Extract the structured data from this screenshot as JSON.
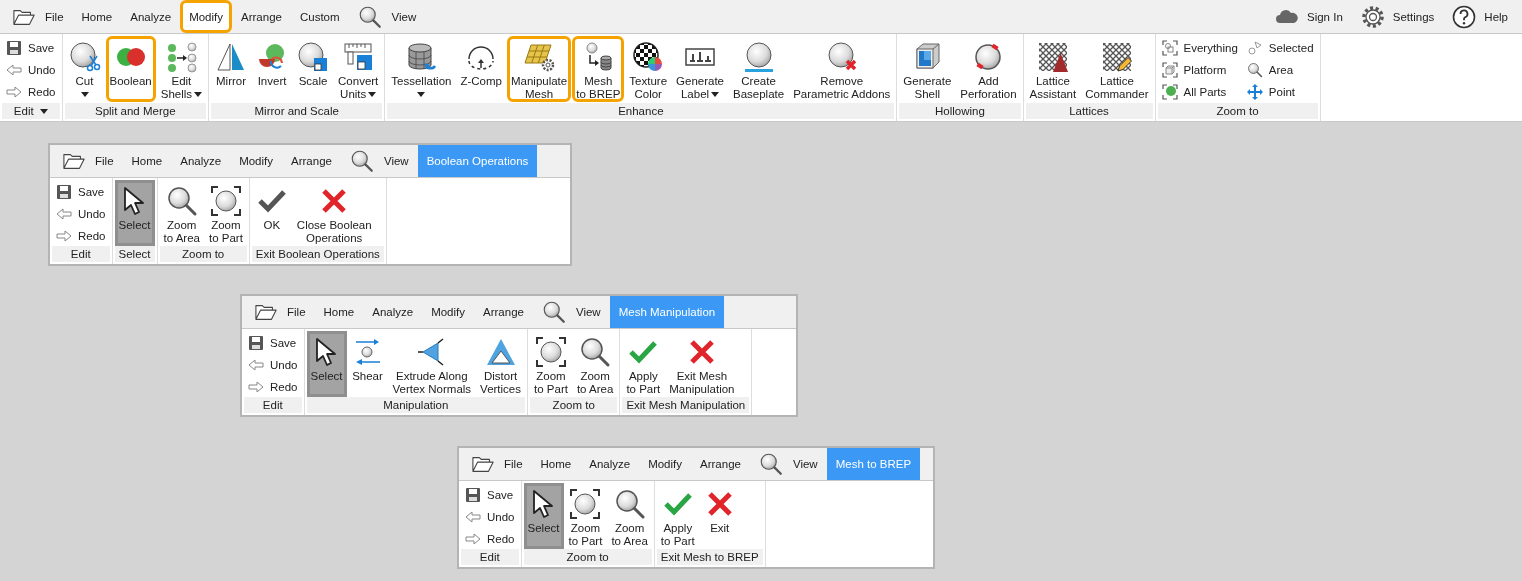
{
  "ribbons": [
    {
      "tabs": [
        {
          "label": "File",
          "kind": "file",
          "selected": false,
          "highlighted": false
        },
        {
          "label": "Home",
          "kind": "plain",
          "selected": false,
          "highlighted": false
        },
        {
          "label": "Analyze",
          "kind": "plain",
          "selected": false,
          "highlighted": false
        },
        {
          "label": "Modify",
          "kind": "plain",
          "selected": true,
          "highlighted": true
        },
        {
          "label": "Arrange",
          "kind": "plain",
          "selected": false,
          "highlighted": false
        },
        {
          "label": "Custom",
          "kind": "plain",
          "selected": false,
          "highlighted": false
        },
        {
          "label": "View",
          "kind": "view",
          "selected": false,
          "highlighted": false
        }
      ],
      "account": [
        {
          "label": "Sign In"
        },
        {
          "label": "Settings"
        },
        {
          "label": "Help"
        }
      ],
      "groups": [
        {
          "label": "Edit",
          "dropdown": true,
          "items": [
            {
              "kind": "stack",
              "items": [
                {
                  "label": "Save"
                },
                {
                  "label": "Undo"
                },
                {
                  "label": "Redo"
                }
              ]
            }
          ]
        },
        {
          "label": "Split and Merge",
          "items": [
            {
              "kind": "large",
              "label": "Cut",
              "dropdown": true,
              "selected": false,
              "highlighted": false
            },
            {
              "kind": "large",
              "label": "Boolean",
              "selected": false,
              "highlighted": true
            },
            {
              "kind": "large",
              "label": "Edit\nShells",
              "dropdown": true,
              "selected": false,
              "highlighted": false
            }
          ]
        },
        {
          "label": "Mirror and Scale",
          "items": [
            {
              "kind": "large",
              "label": "Mirror",
              "selected": false,
              "highlighted": false
            },
            {
              "kind": "large",
              "label": "Invert",
              "selected": false,
              "highlighted": false
            },
            {
              "kind": "large",
              "label": "Scale",
              "selected": false,
              "highlighted": false
            },
            {
              "kind": "large",
              "label": "Convert\nUnits",
              "dropdown": true,
              "selected": false,
              "highlighted": false
            }
          ]
        },
        {
          "label": "Enhance",
          "items": [
            {
              "kind": "large",
              "label": "Tessellation",
              "dropdown": true,
              "selected": false,
              "highlighted": false
            },
            {
              "kind": "large",
              "label": "Z-Comp",
              "selected": false,
              "highlighted": false
            },
            {
              "kind": "large",
              "label": "Manipulate\nMesh",
              "selected": false,
              "highlighted": true
            },
            {
              "kind": "large",
              "label": "Mesh\nto BREP",
              "selected": false,
              "highlighted": true
            },
            {
              "kind": "large",
              "label": "Texture\nColor",
              "selected": false,
              "highlighted": false
            },
            {
              "kind": "large",
              "label": "Generate\nLabel",
              "dropdown": true,
              "selected": false,
              "highlighted": false
            },
            {
              "kind": "large",
              "label": "Create\nBaseplate",
              "selected": false,
              "highlighted": false
            },
            {
              "kind": "large",
              "label": "Remove\nParametric Addons",
              "selected": false,
              "highlighted": false
            }
          ]
        },
        {
          "label": "Hollowing",
          "items": [
            {
              "kind": "large",
              "label": "Generate\nShell",
              "selected": false,
              "highlighted": false
            },
            {
              "kind": "large",
              "label": "Add\nPerforation",
              "selected": false,
              "highlighted": false
            }
          ]
        },
        {
          "label": "Lattices",
          "items": [
            {
              "kind": "large",
              "label": "Lattice\nAssistant",
              "selected": false,
              "highlighted": false
            },
            {
              "kind": "large",
              "label": "Lattice\nCommander",
              "selected": false,
              "highlighted": false
            }
          ]
        },
        {
          "label": "Zoom to",
          "items": [
            {
              "kind": "stack",
              "items": [
                {
                  "label": "Everything"
                },
                {
                  "label": "Platform"
                },
                {
                  "label": "All Parts"
                }
              ]
            },
            {
              "kind": "stack",
              "items": [
                {
                  "label": "Selected"
                },
                {
                  "label": "Area"
                },
                {
                  "label": "Point"
                }
              ]
            }
          ]
        }
      ]
    },
    {
      "tabs": [
        {
          "label": "File",
          "kind": "file",
          "selected": false,
          "highlighted": false
        },
        {
          "label": "Home",
          "kind": "plain",
          "selected": false,
          "highlighted": false
        },
        {
          "label": "Analyze",
          "kind": "plain",
          "selected": false,
          "highlighted": false
        },
        {
          "label": "Modify",
          "kind": "plain",
          "selected": false,
          "highlighted": false
        },
        {
          "label": "Arrange",
          "kind": "plain",
          "selected": false,
          "highlighted": false
        },
        {
          "label": "View",
          "kind": "view",
          "selected": false,
          "highlighted": false
        },
        {
          "label": "Boolean Operations",
          "kind": "context",
          "selected": true,
          "highlighted": false
        }
      ],
      "groups": [
        {
          "label": "Edit",
          "items": [
            {
              "kind": "stack",
              "items": [
                {
                  "label": "Save"
                },
                {
                  "label": "Undo"
                },
                {
                  "label": "Redo"
                }
              ]
            }
          ]
        },
        {
          "label": "Select",
          "items": [
            {
              "kind": "large",
              "label": "Select",
              "selected": true,
              "highlighted": false
            }
          ]
        },
        {
          "label": "Zoom to",
          "items": [
            {
              "kind": "large",
              "label": "Zoom\nto Area",
              "selected": false,
              "highlighted": false
            },
            {
              "kind": "large",
              "label": "Zoom\nto Part",
              "selected": false,
              "highlighted": false
            }
          ]
        },
        {
          "label": "Exit Boolean Operations",
          "items": [
            {
              "kind": "large",
              "label": "OK",
              "selected": false,
              "highlighted": false
            },
            {
              "kind": "large",
              "label": "Close Boolean\nOperations",
              "selected": false,
              "highlighted": false
            }
          ]
        }
      ]
    },
    {
      "tabs": [
        {
          "label": "File",
          "kind": "file",
          "selected": false,
          "highlighted": false
        },
        {
          "label": "Home",
          "kind": "plain",
          "selected": false,
          "highlighted": false
        },
        {
          "label": "Analyze",
          "kind": "plain",
          "selected": false,
          "highlighted": false
        },
        {
          "label": "Modify",
          "kind": "plain",
          "selected": false,
          "highlighted": false
        },
        {
          "label": "Arrange",
          "kind": "plain",
          "selected": false,
          "highlighted": false
        },
        {
          "label": "View",
          "kind": "view",
          "selected": false,
          "highlighted": false
        },
        {
          "label": "Mesh Manipulation",
          "kind": "context",
          "selected": true,
          "highlighted": false
        }
      ],
      "groups": [
        {
          "label": "Edit",
          "items": [
            {
              "kind": "stack",
              "items": [
                {
                  "label": "Save"
                },
                {
                  "label": "Undo"
                },
                {
                  "label": "Redo"
                }
              ]
            }
          ]
        },
        {
          "label": "Manipulation",
          "items": [
            {
              "kind": "large",
              "label": "Select",
              "selected": true,
              "highlighted": false
            },
            {
              "kind": "large",
              "label": "Shear",
              "selected": false,
              "highlighted": false
            },
            {
              "kind": "large",
              "label": "Extrude Along\nVertex Normals",
              "selected": false,
              "highlighted": false
            },
            {
              "kind": "large",
              "label": "Distort\nVertices",
              "selected": false,
              "highlighted": false
            }
          ]
        },
        {
          "label": "Zoom to",
          "items": [
            {
              "kind": "large",
              "label": "Zoom\nto Part",
              "selected": false,
              "highlighted": false
            },
            {
              "kind": "large",
              "label": "Zoom\nto Area",
              "selected": false,
              "highlighted": false
            }
          ]
        },
        {
          "label": "Exit Mesh Manipulation",
          "items": [
            {
              "kind": "large",
              "label": "Apply\nto Part",
              "selected": false,
              "highlighted": false
            },
            {
              "kind": "large",
              "label": "Exit Mesh\nManipulation",
              "selected": false,
              "highlighted": false
            }
          ]
        }
      ]
    },
    {
      "tabs": [
        {
          "label": "File",
          "kind": "file",
          "selected": false,
          "highlighted": false
        },
        {
          "label": "Home",
          "kind": "plain",
          "selected": false,
          "highlighted": false
        },
        {
          "label": "Analyze",
          "kind": "plain",
          "selected": false,
          "highlighted": false
        },
        {
          "label": "Modify",
          "kind": "plain",
          "selected": false,
          "highlighted": false
        },
        {
          "label": "Arrange",
          "kind": "plain",
          "selected": false,
          "highlighted": false
        },
        {
          "label": "View",
          "kind": "view",
          "selected": false,
          "highlighted": false
        },
        {
          "label": "Mesh to BREP",
          "kind": "context",
          "selected": true,
          "highlighted": false
        }
      ],
      "groups": [
        {
          "label": "Edit",
          "items": [
            {
              "kind": "stack",
              "items": [
                {
                  "label": "Save"
                },
                {
                  "label": "Undo"
                },
                {
                  "label": "Redo"
                }
              ]
            }
          ]
        },
        {
          "label": "Zoom to",
          "items": [
            {
              "kind": "large",
              "label": "Select",
              "selected": true,
              "highlighted": false
            },
            {
              "kind": "large",
              "label": "Zoom\nto Part",
              "selected": false,
              "highlighted": false
            },
            {
              "kind": "large",
              "label": "Zoom\nto Area",
              "selected": false,
              "highlighted": false
            }
          ]
        },
        {
          "label": "Exit Mesh to BREP",
          "items": [
            {
              "kind": "large",
              "label": "Apply\nto Part",
              "selected": false,
              "highlighted": false
            },
            {
              "kind": "large",
              "label": "Exit",
              "selected": false,
              "highlighted": false
            }
          ]
        }
      ]
    }
  ]
}
